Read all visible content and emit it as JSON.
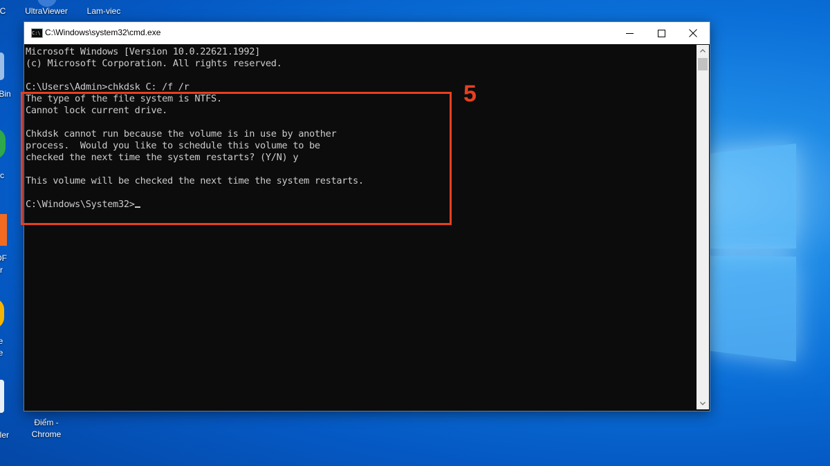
{
  "desktop": {
    "icons": [
      {
        "label": "C"
      },
      {
        "label": "UltraViewer"
      },
      {
        "label": "Lam-viec"
      },
      {
        "label": "Bin"
      },
      {
        "label": "c"
      },
      {
        "label": "DF"
      },
      {
        "label": "r"
      },
      {
        "label": "e"
      },
      {
        "label": "e"
      },
      {
        "label": "ller"
      },
      {
        "label": "Điểm -"
      },
      {
        "label": "Chrome"
      }
    ]
  },
  "window": {
    "title": "C:\\Windows\\system32\\cmd.exe",
    "icon_label": "C:\\"
  },
  "console": {
    "lines": [
      "Microsoft Windows [Version 10.0.22621.1992]",
      "(c) Microsoft Corporation. All rights reserved.",
      "",
      "C:\\Users\\Admin>chkdsk C: /f /r",
      "The type of the file system is NTFS.",
      "Cannot lock current drive.",
      "",
      "Chkdsk cannot run because the volume is in use by another",
      "process.  Would you like to schedule this volume to be",
      "checked the next time the system restarts? (Y/N) y",
      "",
      "This volume will be checked the next time the system restarts.",
      "",
      "C:\\Windows\\System32>"
    ]
  },
  "annotation": {
    "step_number": "5",
    "color": "#e8401f"
  },
  "colors": {
    "console_bg": "#0c0c0c",
    "console_text": "#cccccc"
  }
}
